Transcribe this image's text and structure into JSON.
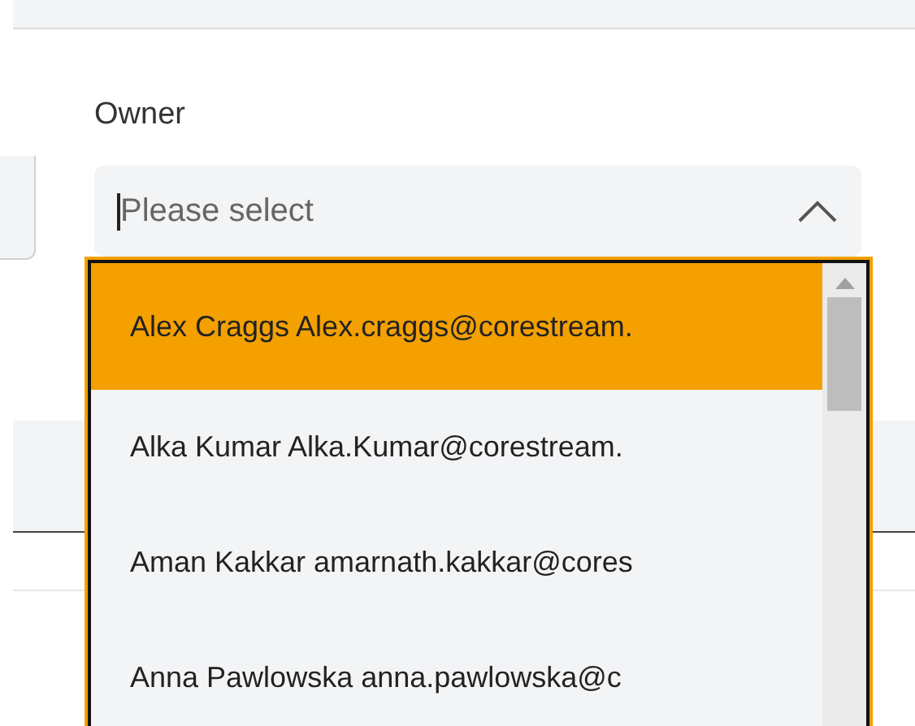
{
  "field": {
    "label": "Owner",
    "placeholder": "Please select",
    "expanded": true
  },
  "options": [
    {
      "text": "Alex Craggs Alex.craggs@corestream.",
      "selected": true
    },
    {
      "text": "Alka Kumar Alka.Kumar@corestream.",
      "selected": false
    },
    {
      "text": "Aman Kakkar amarnath.kakkar@cores",
      "selected": false
    },
    {
      "text": "Anna Pawlowska anna.pawlowska@c",
      "selected": false
    }
  ]
}
